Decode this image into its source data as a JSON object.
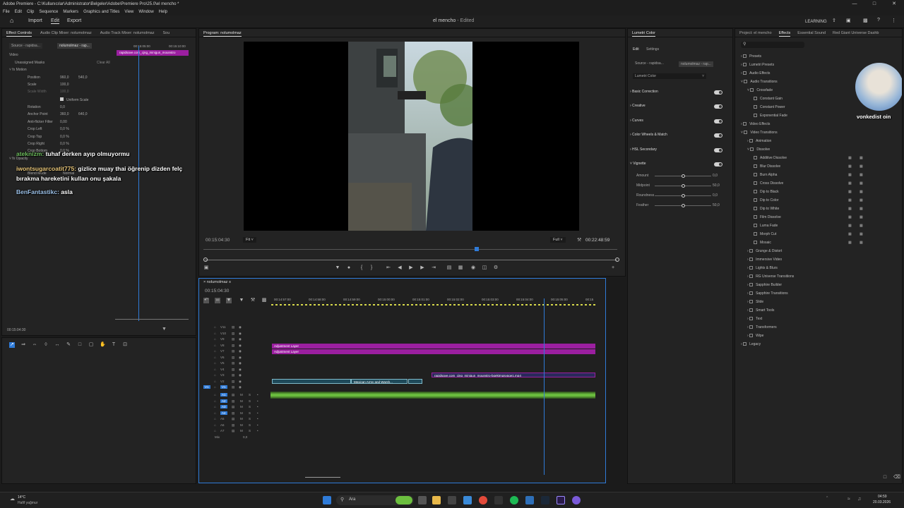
{
  "app": {
    "title": "Adobe Premiere - C:\\Kullanıcılar\\Administrator\\Belgeler\\Adobe\\Premiere Pro\\25.0\\el mencho *",
    "menu": [
      "File",
      "Edit",
      "Clip",
      "Sequence",
      "Markers",
      "Graphics and Titles",
      "View",
      "Window",
      "Help"
    ],
    "workspaces": [
      "Import",
      "Edit",
      "Export"
    ],
    "active_workspace": "Edit",
    "project_title": "el mencho",
    "project_status": "- Edited",
    "learning": "LEARNING"
  },
  "effect_controls": {
    "tabs": [
      "Effect Controls",
      "Audio Clip Mixer: nolumolmaz",
      "Audio Track Mixer: nolumolmaz",
      "Sou"
    ],
    "source": "Source - rapidsa...",
    "sequence": "nolumolmaz - rap...",
    "clip_name": "rapidsave.com_cjng_minigun_mounstro",
    "ruler_times": [
      "00:15:05:00",
      "00:15:10:00"
    ],
    "video_label": "Video",
    "masks_label": "Unassigned Masks",
    "clear_all": "Clear All",
    "motion": "Motion",
    "properties": [
      {
        "name": "Position",
        "v1": "960,0",
        "v2": "540,0"
      },
      {
        "name": "Scale",
        "v1": "100,0",
        "v2": ""
      },
      {
        "name": "Scale Width",
        "v1": "100,0",
        "v2": ""
      },
      {
        "name": "Uniform Scale",
        "v1": "",
        "v2": ""
      },
      {
        "name": "Rotation",
        "v1": "0,0",
        "v2": ""
      },
      {
        "name": "Anchor Point",
        "v1": "360,0",
        "v2": "640,0"
      },
      {
        "name": "Anti-flicker Filter",
        "v1": "0,00",
        "v2": ""
      },
      {
        "name": "Crop Left",
        "v1": "0,0 %",
        "v2": ""
      },
      {
        "name": "Crop Top",
        "v1": "0,0 %",
        "v2": ""
      },
      {
        "name": "Crop Right",
        "v1": "0,0 %",
        "v2": ""
      },
      {
        "name": "Crop Bottom",
        "v1": "0,0 %",
        "v2": ""
      }
    ],
    "opacity": "Opacity",
    "blend_mode": "Blend Mode",
    "blend_value": "Normal",
    "timecode": "00:15:04:30"
  },
  "chat": [
    {
      "user": "ateknizm:",
      "msg": "tuhaf derken ayıp olmuyormu"
    },
    {
      "user": "iwontsugarcoatit775:",
      "msg": "gizlice muay thai öğrenip dizden felç"
    },
    {
      "user": "",
      "msg": "bırakma hareketini kullan onu şakala"
    },
    {
      "user": "BenFantastikc:",
      "msg": "asla"
    }
  ],
  "program": {
    "tab": "Program: nolumolmaz",
    "timecode": "00:15:04:30",
    "fit": "Fit",
    "quality": "Full",
    "duration": "00:22:48:59"
  },
  "timeline": {
    "sequence": "nolumolmaz",
    "timecode": "00:15:04:30",
    "ruler": [
      "00:14:57:00",
      "00:14:58:00",
      "00:14:59:00",
      "00:15:00:00",
      "00:15:01:00",
      "00:15:02:00",
      "00:15:03:00",
      "00:15:04:00",
      "00:15:05:00",
      "00:15"
    ],
    "video_tracks": [
      "V11",
      "V10",
      "V9",
      "V8",
      "V7",
      "V6",
      "V5",
      "V4",
      "V3",
      "V2",
      "V1"
    ],
    "audio_tracks": [
      "A1",
      "A2",
      "A3",
      "A4",
      "A5",
      "A6",
      "A7"
    ],
    "mix": "Mix",
    "mix_value": "0,0",
    "clips": {
      "adj1": "Adjustment Layer",
      "adj2": "Adjustment Layer",
      "mexican": "Mexican Army and Warsh...",
      "rapidsave": "rapidsave.com_cjng_minigun_mounstro-bgektmqsvpqe1.mp4",
      "fx": "fx"
    }
  },
  "lumetri": {
    "tab": "Lumetri Color",
    "subtabs": [
      "Edit",
      "Settings"
    ],
    "source": "Source - rapidsa...",
    "sequence": "nolumolmaz - rap...",
    "effect": "Lumetri Color",
    "sections": [
      "Basic Correction",
      "Creative",
      "Curves",
      "Color Wheels & Match",
      "HSL Secondary",
      "Vignette"
    ],
    "vignette": [
      {
        "name": "Amount",
        "value": "0,0",
        "level": 0.5
      },
      {
        "name": "Midpoint",
        "value": "50,0",
        "level": 0.5
      },
      {
        "name": "Roundness",
        "value": "0,0",
        "level": 0.5
      },
      {
        "name": "Feather",
        "value": "50,0",
        "level": 0.5
      }
    ]
  },
  "effects": {
    "tabs": [
      "Project: el mencho",
      "Effects",
      "Essential Sound",
      "Red Giant Universe Dashb"
    ],
    "tree": [
      {
        "label": "Presets",
        "depth": 0
      },
      {
        "label": "Lumetri Presets",
        "depth": 0
      },
      {
        "label": "Audio Effects",
        "depth": 0
      },
      {
        "label": "Audio Transitions",
        "depth": 0
      },
      {
        "label": "Crossfade",
        "depth": 1
      },
      {
        "label": "Constant Gain",
        "depth": 2
      },
      {
        "label": "Constant Power",
        "depth": 2
      },
      {
        "label": "Exponential Fade",
        "depth": 2
      },
      {
        "label": "Video Effects",
        "depth": 0
      },
      {
        "label": "Video Transitions",
        "depth": 0
      },
      {
        "label": "Animation",
        "depth": 1
      },
      {
        "label": "Dissolve",
        "depth": 1
      },
      {
        "label": "Additive Dissolve",
        "depth": 2
      },
      {
        "label": "Blur Dissolve",
        "depth": 2
      },
      {
        "label": "Burn Alpha",
        "depth": 2
      },
      {
        "label": "Cross Dissolve",
        "depth": 2
      },
      {
        "label": "Dip to Black",
        "depth": 2
      },
      {
        "label": "Dip to Color",
        "depth": 2
      },
      {
        "label": "Dip to White",
        "depth": 2
      },
      {
        "label": "Film Dissolve",
        "depth": 2
      },
      {
        "label": "Luma Fade",
        "depth": 2
      },
      {
        "label": "Morph Cut",
        "depth": 2
      },
      {
        "label": "Mosaic",
        "depth": 2
      },
      {
        "label": "Grunge & Distort",
        "depth": 1
      },
      {
        "label": "Immersive Video",
        "depth": 1
      },
      {
        "label": "Lights & Blurs",
        "depth": 1
      },
      {
        "label": "RG Universe Transitions",
        "depth": 1
      },
      {
        "label": "Sapphire Builder",
        "depth": 1
      },
      {
        "label": "Sapphire Transitions",
        "depth": 1
      },
      {
        "label": "Slide",
        "depth": 1
      },
      {
        "label": "Smart Tools",
        "depth": 1
      },
      {
        "label": "Text",
        "depth": 1
      },
      {
        "label": "Transformers",
        "depth": 1
      },
      {
        "label": "Wipe",
        "depth": 1
      },
      {
        "label": "Legacy",
        "depth": 0
      }
    ],
    "webcam_name": "vonkedist oin"
  },
  "taskbar": {
    "weather_temp": "14°C",
    "weather_desc": "Hafif yağmur",
    "search": "Ara",
    "time": "04:59",
    "date": "20.03.2026"
  },
  "colors": {
    "accent": "#2f7bd8",
    "adjustment": "#9b1fa0",
    "video_clip": "#1f4a5a",
    "audio": "#6cbf3f"
  }
}
